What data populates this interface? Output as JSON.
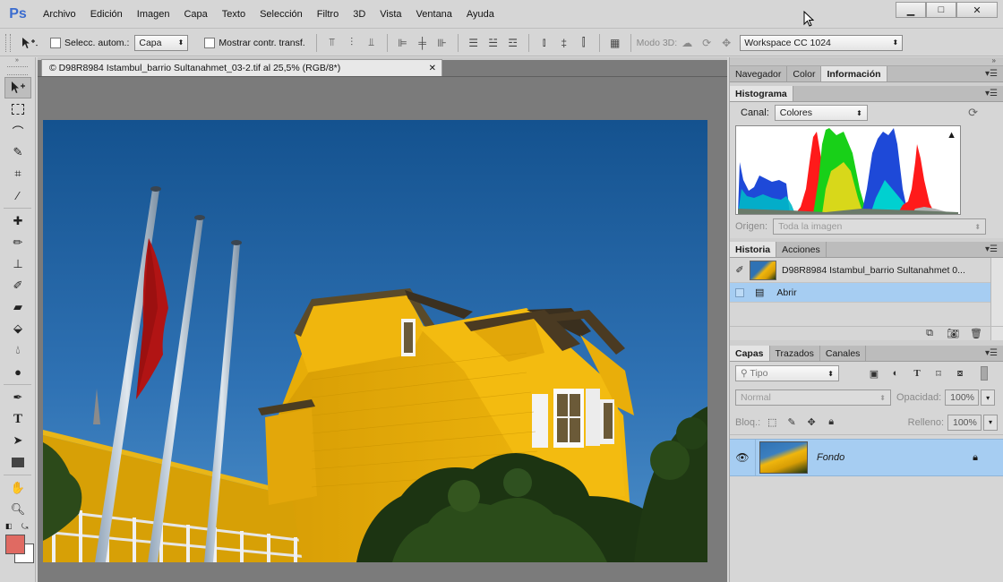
{
  "app": {
    "logo": "Ps"
  },
  "menu": [
    "Archivo",
    "Edición",
    "Imagen",
    "Capa",
    "Texto",
    "Selección",
    "Filtro",
    "3D",
    "Vista",
    "Ventana",
    "Ayuda"
  ],
  "window_controls": {
    "minimize": "▁",
    "maximize": "□",
    "close": "✕"
  },
  "options": {
    "auto_select_label": "Selecc. autom.:",
    "auto_select_value": "Capa",
    "show_transform_label": "Mostrar contr. transf.",
    "mode3d_label": "Modo 3D:",
    "workspace": "Workspace CC 1024"
  },
  "document": {
    "tab_title": "© D98R8984 Istambul_barrio Sultanahmet_03-2.tif al 25,5% (RGB/8*)",
    "tab_close": "✕"
  },
  "panels": {
    "top_tabs": [
      "Navegador",
      "Color",
      "Información"
    ],
    "histogram": {
      "tab": "Histograma",
      "channel_label": "Canal:",
      "channel_value": "Colores",
      "source_label": "Origen:",
      "source_value": "Toda la imagen",
      "warning": "▲"
    },
    "history": {
      "tabs": [
        "Historia",
        "Acciones"
      ],
      "snapshot": "D98R8984 Istambul_barrio Sultanahmet 0...",
      "states": [
        "Abrir"
      ]
    },
    "layers": {
      "tabs": [
        "Capas",
        "Trazados",
        "Canales"
      ],
      "filter_placeholder": "Tipo",
      "blend_mode": "Normal",
      "opacity_label": "Opacidad:",
      "opacity_value": "100%",
      "lock_label": "Bloq.:",
      "fill_label": "Relleno:",
      "fill_value": "100%",
      "layer_name": "Fondo"
    }
  },
  "colors": {
    "foreground": "#e06a62",
    "background": "#ffffff",
    "selection": "#a6cdf2"
  }
}
